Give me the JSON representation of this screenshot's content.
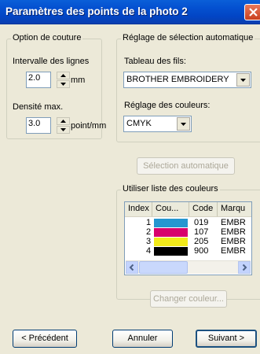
{
  "window": {
    "title": "Paramètres des points de la photo 2"
  },
  "couture": {
    "legend": "Option de couture",
    "interval_label": "Intervalle des lignes",
    "interval_value": "2.0",
    "interval_unit": "mm",
    "density_label": "Densité max.",
    "density_value": "3.0",
    "density_unit": "point/mm"
  },
  "auto": {
    "legend": "Réglage de sélection automatique",
    "table_label": "Tableau des fils:",
    "table_value": "BROTHER EMBROIDERY",
    "color_label": "Réglage des couleurs:",
    "color_value": "CMYK",
    "auto_button": "Sélection automatique"
  },
  "colorlist": {
    "legend": "Utiliser liste des couleurs",
    "columns": [
      "Index",
      "Cou...",
      "Code",
      "Marqu"
    ],
    "rows": [
      {
        "index": "1",
        "color": "#2596d0",
        "code": "019",
        "brand": "EMBR"
      },
      {
        "index": "2",
        "color": "#d8006c",
        "code": "107",
        "brand": "EMBR"
      },
      {
        "index": "3",
        "color": "#f2ea1a",
        "code": "205",
        "brand": "EMBR"
      },
      {
        "index": "4",
        "color": "#000000",
        "code": "900",
        "brand": "EMBR"
      }
    ],
    "change_button": "Changer couleur..."
  },
  "footer": {
    "prev": "< Précédent",
    "cancel": "Annuler",
    "next": "Suivant >"
  }
}
